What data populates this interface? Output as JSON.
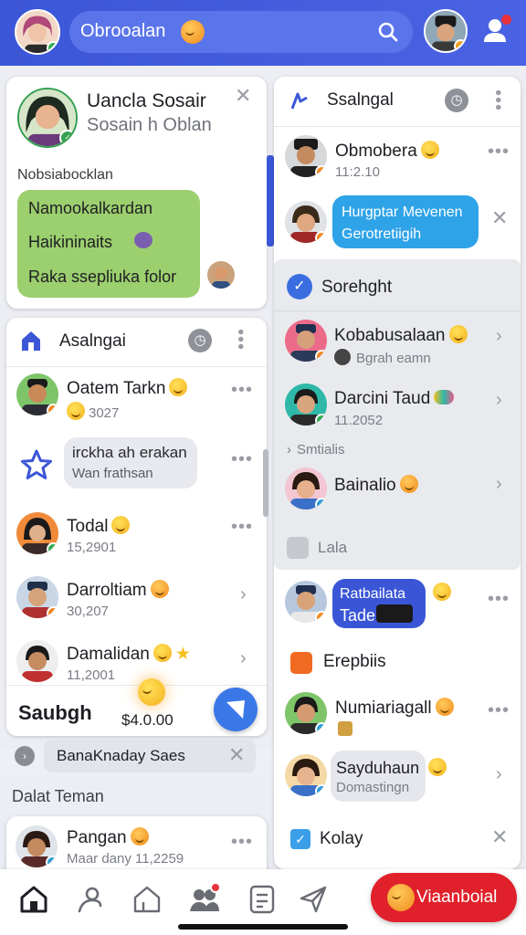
{
  "header": {
    "search_value": "Obrooalan",
    "colors": {
      "bar": "#3c57d8",
      "search_bg": "#5a74ea"
    }
  },
  "left": {
    "profile": {
      "name": "Uancla Sosair",
      "subtitle": "Sosain h Oblan",
      "label": "Nobsiabocklan"
    },
    "chat": [
      "Namookalkardan",
      "Haikininaits",
      "Raka ssepliuka folor"
    ],
    "panel": {
      "title": "Asalngai",
      "items": [
        {
          "name": "Oatem Tarkn",
          "sub": "3027"
        },
        {
          "bubble1": "irckha ah erakan",
          "bubble2": "Wan frathsan"
        },
        {
          "name": "Todal",
          "sub": "15,2901"
        },
        {
          "name": "Darroltiam",
          "sub": "30,207"
        },
        {
          "name": "Damalidan",
          "sub": "11,2001"
        }
      ],
      "footer_label": "Saubgh",
      "footer_price": "$4.0.00"
    },
    "notice": "BanaKnaday Saes",
    "section_label": "Dalat Teman",
    "bottom_card": {
      "name": "Pangan",
      "sub": "Maar dany 11,2259"
    }
  },
  "right": {
    "title": "Ssalngal",
    "items": [
      {
        "name": "Obmobera",
        "sub": "11:2.10"
      },
      {
        "bubble1": "Hurgptar Mevenen",
        "bubble2": "Gerotretiigih"
      }
    ],
    "group": {
      "title": "Sorehght",
      "items": [
        {
          "name": "Kobabusalaan",
          "sub": "Bgrah eamn"
        },
        {
          "name": "Darcini Taud",
          "sub": "11.2052"
        }
      ],
      "subsection": "Smtialis",
      "item3": {
        "name": "Bainalio"
      },
      "lala": "Lala"
    },
    "sticker": {
      "line1": "Ratbailata",
      "line2": "Tade"
    },
    "erepbiis": "Erepbiis",
    "numiariagall": "Numiariagall",
    "sayduhaun": {
      "name": "Sayduhaun",
      "sub": "Domastingn"
    },
    "kolay": "Kolay"
  },
  "bottom_nav": {
    "cta_label": "Viaanboial"
  }
}
